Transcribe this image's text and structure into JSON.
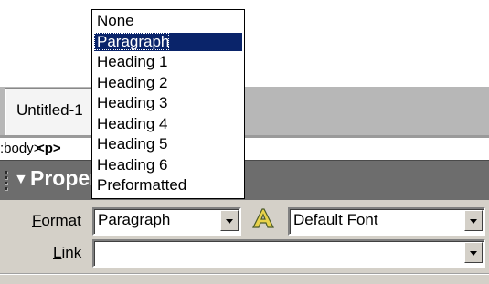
{
  "document_tabs": [
    {
      "label": "Untitled-1"
    }
  ],
  "tag_selector": {
    "body": ":body>",
    "p": "<p>"
  },
  "property_inspector": {
    "title": "Properties",
    "format_label": "Format",
    "format_value": "Paragraph",
    "font_value": "Default Font",
    "link_label": "Link",
    "link_value": ""
  },
  "format_dropdown": {
    "options": [
      "None",
      "Paragraph",
      "Heading 1",
      "Heading 2",
      "Heading 3",
      "Heading 4",
      "Heading 5",
      "Heading 6",
      "Preformatted"
    ],
    "selected": "Paragraph"
  },
  "icons": {
    "collapse_arrow": "triangle-down-icon",
    "font_style_icon": "font-A-icon",
    "dropdown_arrow": "chevron-down-icon"
  },
  "colors": {
    "selection": "#0a246a",
    "panel_header": "#6d6d6d",
    "panel_body": "#d4d0c8",
    "tab_strip": "#b7b7b7"
  }
}
